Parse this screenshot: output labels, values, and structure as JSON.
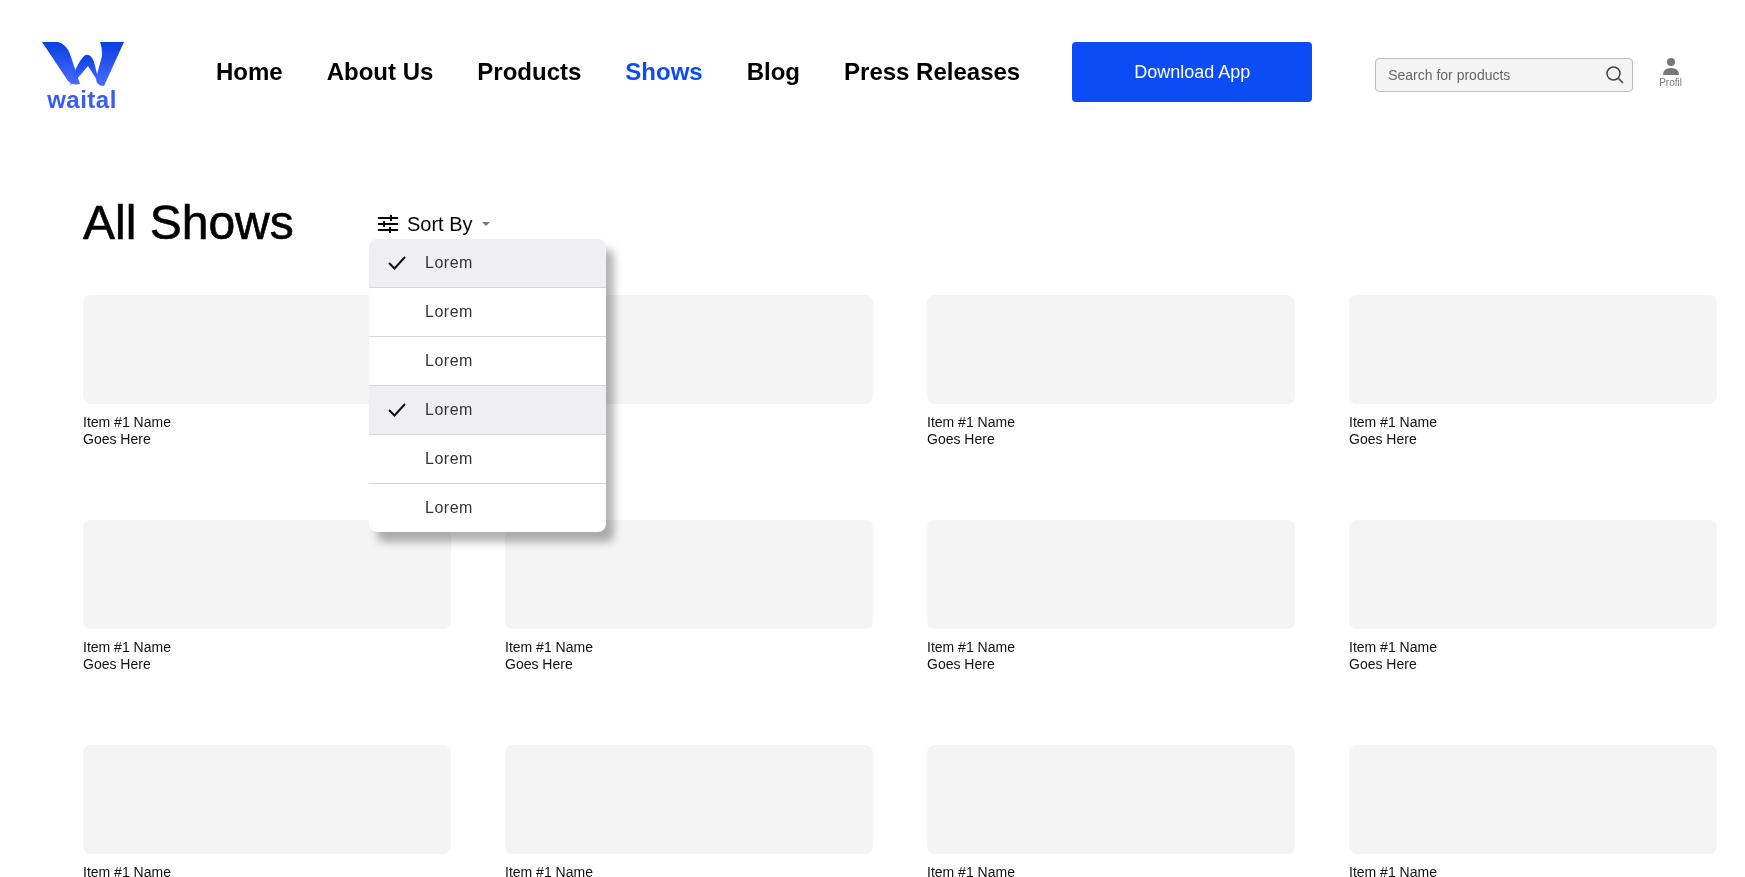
{
  "logo": {
    "text": "waital"
  },
  "nav": [
    {
      "label": "Home",
      "selected": false
    },
    {
      "label": "About Us",
      "selected": false
    },
    {
      "label": "Products",
      "selected": false
    },
    {
      "label": "Shows",
      "selected": true
    },
    {
      "label": "Blog",
      "selected": false
    },
    {
      "label": "Press Releases",
      "selected": false
    }
  ],
  "download_button": "Download App",
  "search": {
    "placeholder": "Search for products"
  },
  "profile": {
    "label": "Profil"
  },
  "page_title": "All Shows",
  "sort": {
    "label": "Sort By",
    "options": [
      {
        "label": "Lorem",
        "checked": true
      },
      {
        "label": "Lorem",
        "checked": false
      },
      {
        "label": "Lorem",
        "checked": false
      },
      {
        "label": "Lorem",
        "checked": true
      },
      {
        "label": "Lorem",
        "checked": false
      },
      {
        "label": "Lorem",
        "checked": false
      }
    ]
  },
  "items": [
    {
      "kind": "captioned",
      "lines": [
        "Item #1 Name",
        "Goes Here"
      ]
    },
    {
      "kind": "thumbnail"
    },
    {
      "kind": "captioned",
      "lines": [
        "Item #1 Name",
        "Goes Here"
      ]
    },
    {
      "kind": "captioned",
      "lines": [
        "Item #1 Name",
        "Goes Here"
      ]
    },
    {
      "kind": "captioned",
      "lines": [
        "Item #1 Name",
        "Goes Here"
      ]
    },
    {
      "kind": "captioned",
      "lines": [
        "Item #1 Name",
        "Goes Here"
      ]
    },
    {
      "kind": "captioned",
      "lines": [
        "Item #1 Name",
        "Goes Here"
      ]
    },
    {
      "kind": "captioned",
      "lines": [
        "Item #1 Name",
        "Goes Here"
      ]
    },
    {
      "kind": "captioned",
      "lines": [
        "Item #1 Name"
      ]
    },
    {
      "kind": "captioned",
      "lines": [
        "Item #1 Name"
      ]
    },
    {
      "kind": "captioned",
      "lines": [
        "Item #1 Name"
      ]
    },
    {
      "kind": "captioned",
      "lines": [
        "Item #1 Name"
      ]
    }
  ]
}
